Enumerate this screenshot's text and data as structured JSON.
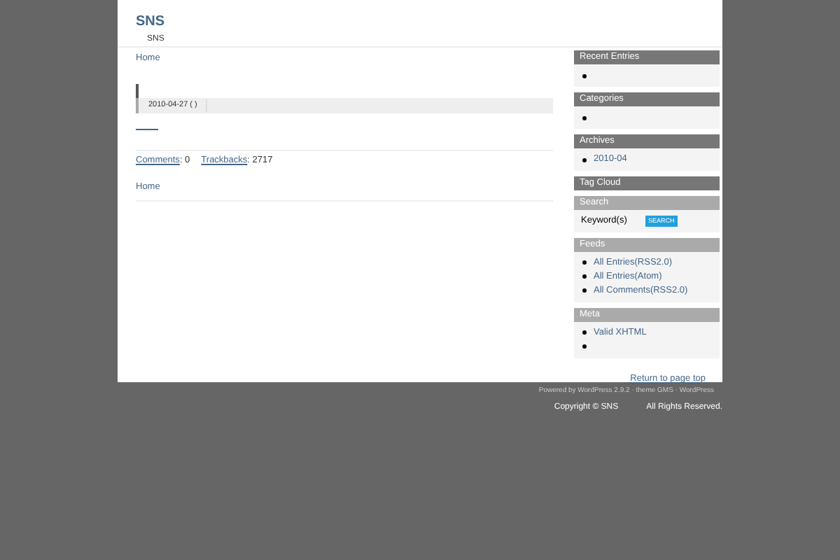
{
  "site": {
    "title": "SNS",
    "tagline": "SNS"
  },
  "breadcrumb_top": "Home",
  "post": {
    "date": "2010-04-27 ( )",
    "comments_label": "Comments",
    "comments_count": ": 0",
    "trackbacks_label": "Trackbacks",
    "trackbacks_count": ": 2717"
  },
  "breadcrumb_bottom": "Home",
  "sidebar": [
    {
      "kind": "list",
      "heading": "Recent Entries",
      "color": "#777777",
      "items": [
        {
          "kind": "empty"
        }
      ]
    },
    {
      "kind": "list",
      "heading": "Categories",
      "color": "#777777",
      "items": [
        {
          "kind": "empty"
        }
      ]
    },
    {
      "kind": "list",
      "heading": "Archives",
      "color": "#777777",
      "items": [
        {
          "kind": "link",
          "text": "2010-04"
        }
      ]
    },
    {
      "kind": "list",
      "heading": "Tag Cloud",
      "color": "#777777"
    },
    {
      "kind": "search",
      "heading": "Search",
      "color": "#aaaaaa",
      "label": "Keyword(s)",
      "button": "SEARCH"
    },
    {
      "kind": "list",
      "heading": "Feeds",
      "color": "#aaaaaa",
      "items": [
        {
          "kind": "link",
          "text": "All Entries(RSS2.0)"
        },
        {
          "kind": "link",
          "text": "All Entries(Atom)"
        },
        {
          "kind": "link",
          "text": "All Comments(RSS2.0)"
        }
      ]
    },
    {
      "kind": "list",
      "heading": "Meta",
      "color": "#aaaaaa",
      "items": [
        {
          "kind": "link",
          "text": "Valid XHTML"
        },
        {
          "kind": "empty"
        }
      ]
    }
  ],
  "return_link": "Return to page top",
  "footer": {
    "powered": "Powered by WordPress 2.9.2 · theme GMS · WordPress",
    "copyright": "Copyright © SNS",
    "rights": "All Rights Reserved."
  }
}
